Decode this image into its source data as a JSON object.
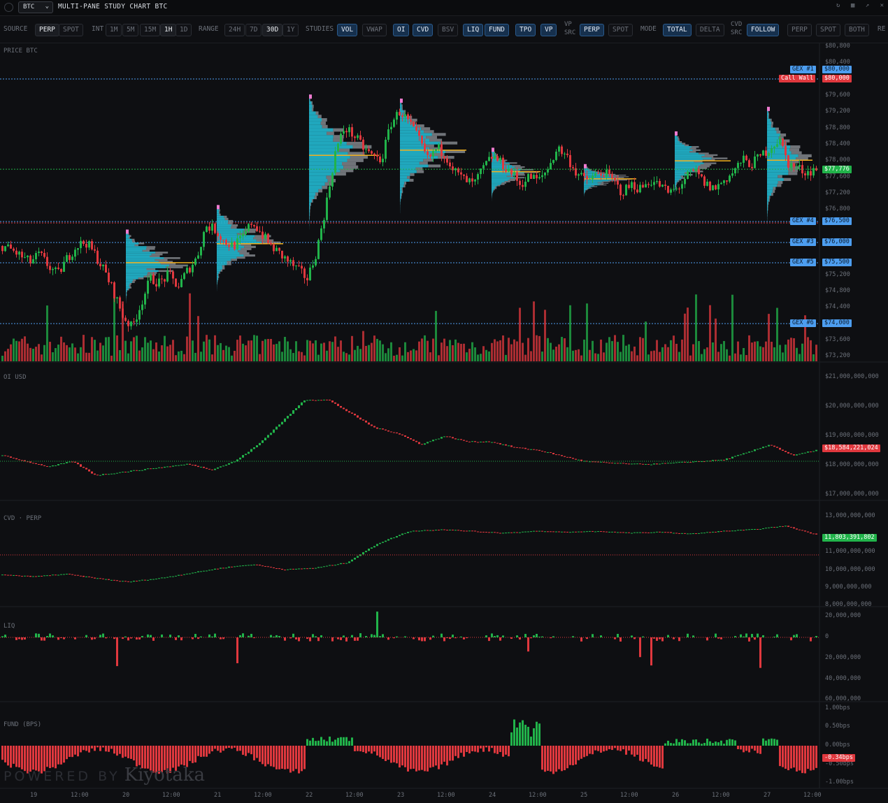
{
  "header": {
    "symbol": "BTC",
    "title": "MULTI-PANE STUDY CHART BTC"
  },
  "toolbar": {
    "source_label": "SOURCE",
    "source_opts": [
      "PERP",
      "SPOT"
    ],
    "int_label": "INT",
    "int_opts": [
      "1M",
      "5M",
      "15M",
      "1H",
      "1D"
    ],
    "range_label": "RANGE",
    "range_opts": [
      "24H",
      "7D",
      "30D",
      "1Y"
    ],
    "studies_label": "STUDIES",
    "studies": [
      "VOL",
      "VWAP",
      "OI",
      "CVD",
      "BSV",
      "LIQ",
      "FUND",
      "TPO",
      "VP"
    ],
    "vpsrc_label": [
      "VP",
      "SRC"
    ],
    "vpsrc_opts": [
      "PERP",
      "SPOT"
    ],
    "mode_label": "MODE",
    "mode_opts": [
      "TOTAL",
      "DELTA"
    ],
    "cvdsrc_label": [
      "CVD",
      "SRC"
    ],
    "cvdsrc_opts": [
      "FOLLOW",
      "PERP",
      "SPOT",
      "BOTH",
      "RE"
    ]
  },
  "panes": {
    "price_label": "PRICE BTC",
    "oi_label": "OI USD",
    "cvd_label": "CVD · PERP",
    "liq_label": "LIQ",
    "fund_label": "FUND (BPS)"
  },
  "price_axis": [
    "$80,800",
    "$80,400",
    "$79,600",
    "$79,200",
    "$78,800",
    "$78,400",
    "$78,000",
    "$77,600",
    "$77,200",
    "$76,800",
    "$75,200",
    "$74,800",
    "$74,400",
    "$73,600",
    "$73,200"
  ],
  "oi_axis": [
    "$21,000,000,000",
    "$20,000,000,000",
    "$19,000,000,000",
    "$18,000,000,000",
    "$17,000,000,000"
  ],
  "cvd_axis": [
    "13,000,000,000",
    "11,000,000,000",
    "10,000,000,000",
    "9,000,000,000",
    "8,000,000,000"
  ],
  "liq_axis": [
    "20,000,000",
    "0",
    "20,000,000",
    "40,000,000",
    "60,000,000"
  ],
  "fund_axis": [
    "1.00bps",
    "0.50bps",
    "0.00bps",
    "-0.50bps",
    "-1.00bps"
  ],
  "tags": {
    "gex1": "GEX #1",
    "gex1_v": "$80,000",
    "call_wall": "Call Wall",
    "call_wall_v": "$80,000",
    "last_price": "$77,776",
    "gex4": "GEX #4",
    "gex4_v": "$76,500",
    "gex3": "GEX #3",
    "gex3_v": "$76,000",
    "gex5": "GEX #5",
    "gex5_v": "$75,500",
    "gex6": "GEX #6",
    "gex6_v": "$74,000",
    "oi_last": "$18,584,221,024",
    "cvd_last": "11,803,391,802",
    "fund_last": "-0.34bps"
  },
  "x_axis": [
    "19",
    "12:00",
    "20",
    "12:00",
    "21",
    "12:00",
    "22",
    "12:00",
    "23",
    "12:00",
    "24",
    "12:00",
    "25",
    "12:00",
    "26",
    "12:00",
    "27",
    "12:00"
  ],
  "branding": {
    "powered": "POWERED BY",
    "name": "Kiyotaka"
  },
  "colors": {
    "up": "#21b34a",
    "down": "#e0383e",
    "blue": "#4d9ef0",
    "vp": "#22b8d0",
    "poc": "#f2b01e"
  },
  "chart_data": {
    "type": "candlestick",
    "x_range": [
      "19",
      "27 12:00"
    ],
    "price_ylim": [
      73200,
      80800
    ],
    "price_path": [
      75900,
      75800,
      75650,
      75500,
      75700,
      75400,
      75200,
      75600,
      75900,
      76000,
      75700,
      75300,
      74800,
      74200,
      73900,
      74500,
      75100,
      75000,
      75200,
      74900,
      75300,
      75600,
      76400,
      76300,
      76000,
      75900,
      76100,
      76500,
      76200,
      75900,
      75700,
      75500,
      75300,
      75100,
      75800,
      76900,
      78200,
      78800,
      78600,
      78300,
      78100,
      78000,
      78900,
      79200,
      78900,
      78500,
      78000,
      78300,
      78100,
      77700,
      77500,
      77400,
      77800,
      78100,
      77900,
      77700,
      77400,
      77600,
      77500,
      77800,
      78300,
      78100,
      77700,
      77500,
      77600,
      77700,
      77500,
      77200,
      77400,
      77300,
      77500,
      77400,
      77200,
      77300,
      77600,
      77700,
      77400,
      77300,
      77500,
      77700,
      78000,
      77900,
      78100,
      78300,
      78500,
      77900,
      77800,
      77700,
      77800
    ],
    "oi_ylim": [
      17000000000,
      21000000000
    ],
    "cvd_ylim": [
      8000000000,
      13000000000
    ],
    "liq_ylim": [
      -60000000,
      20000000
    ],
    "fund_ylim": [
      -1.0,
      1.0
    ]
  }
}
